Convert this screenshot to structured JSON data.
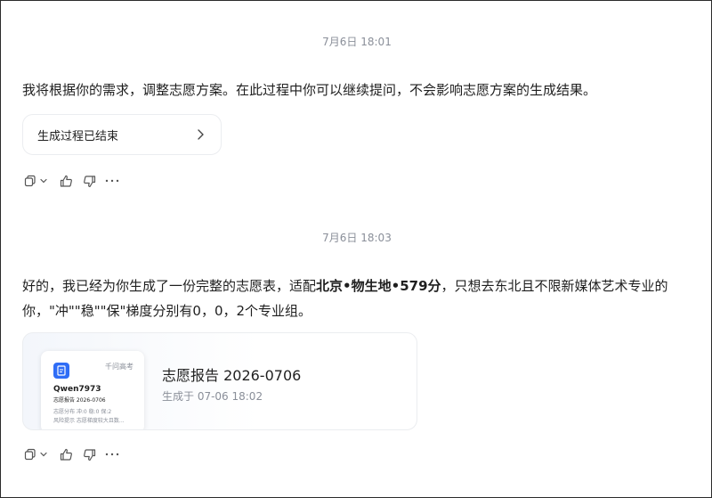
{
  "conversation": [
    {
      "timestamp": "7月6日 18:01",
      "text": "我将根据你的需求，调整志愿方案。在此过程中你可以继续提问，不会影响志愿方案的生成结果。",
      "process_card": {
        "label": "生成过程已结束"
      }
    },
    {
      "timestamp": "7月6日 18:03",
      "text_before": "好的，我已经为你生成了一份完整的志愿表，适配",
      "text_bold": "北京•物生地•579分",
      "text_after_line1": "，只想去东北且不限新媒体艺术专业的",
      "text_line2": "你，\"冲\"\"稳\"\"保\"梯度分别有0，0，2个专业组。",
      "report_card": {
        "thumbnail": {
          "brand": "千问高考",
          "user": "Qwen7973",
          "subtitle": "志愿报告 2026-0706",
          "stats": "志愿分布  冲:0  稳:0  保:2",
          "risk": "风险提示  志愿梯度较大且数..."
        },
        "title": "志愿报告 2026-0706",
        "subtitle": "生成于 07-06 18:02"
      }
    }
  ],
  "icons": [
    "copy-icon",
    "chevron-down-icon",
    "thumbs-up-icon",
    "thumbs-down-icon",
    "more-icon",
    "chevron-right-icon",
    "document-icon"
  ],
  "colors": {
    "accent": "#2f6df6",
    "muted": "#8a8f99",
    "border": "#ebedf0"
  }
}
